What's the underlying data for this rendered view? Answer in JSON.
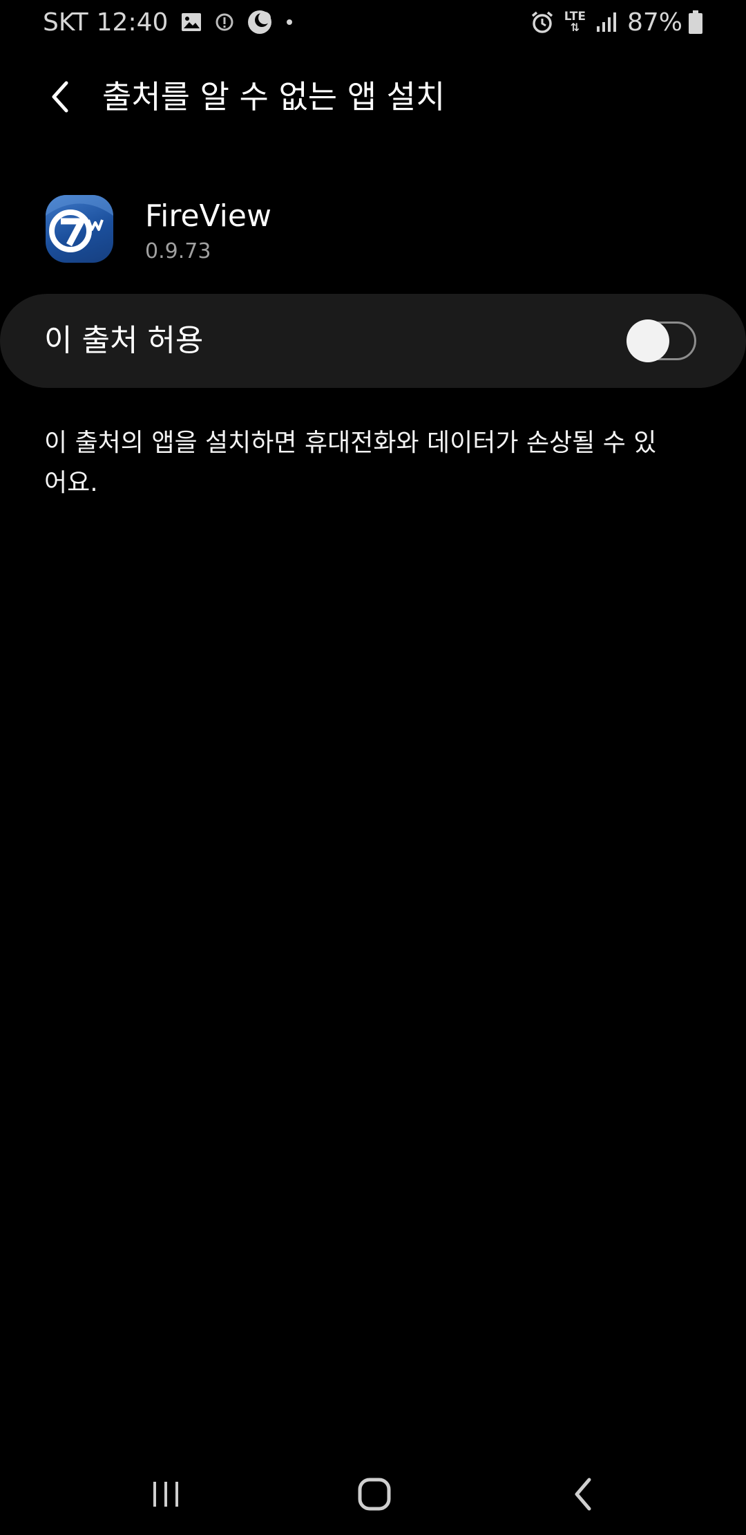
{
  "status_bar": {
    "carrier": "SKT",
    "time": "12:40",
    "left_icons": [
      "image-icon",
      "info-circle-icon",
      "do-not-disturb-moon-icon",
      "dot-icon"
    ],
    "right_icons": [
      "alarm-icon",
      "lte-icon",
      "signal-icon",
      "battery-icon"
    ],
    "network": "LTE",
    "battery_percent": "87%"
  },
  "header": {
    "back_icon": "chevron-left-icon",
    "title": "출처를 알 수 없는 앱 설치"
  },
  "app": {
    "icon": "fireview-app-icon",
    "name": "FireView",
    "version": "0.9.73"
  },
  "allow_setting": {
    "label": "이 출처 허용",
    "enabled": false
  },
  "warning": {
    "text": "이 출처의 앱을 설치하면 휴대전화와 데이터가 손상될 수 있어요."
  },
  "nav_bar": {
    "buttons": [
      "recent-apps-icon",
      "home-icon",
      "back-icon"
    ]
  },
  "colors": {
    "background": "#000000",
    "card": "#1b1b1b",
    "text_primary": "#ffffff",
    "text_secondary": "#a0a0a0",
    "app_icon_blue": "#1b4f9c"
  }
}
